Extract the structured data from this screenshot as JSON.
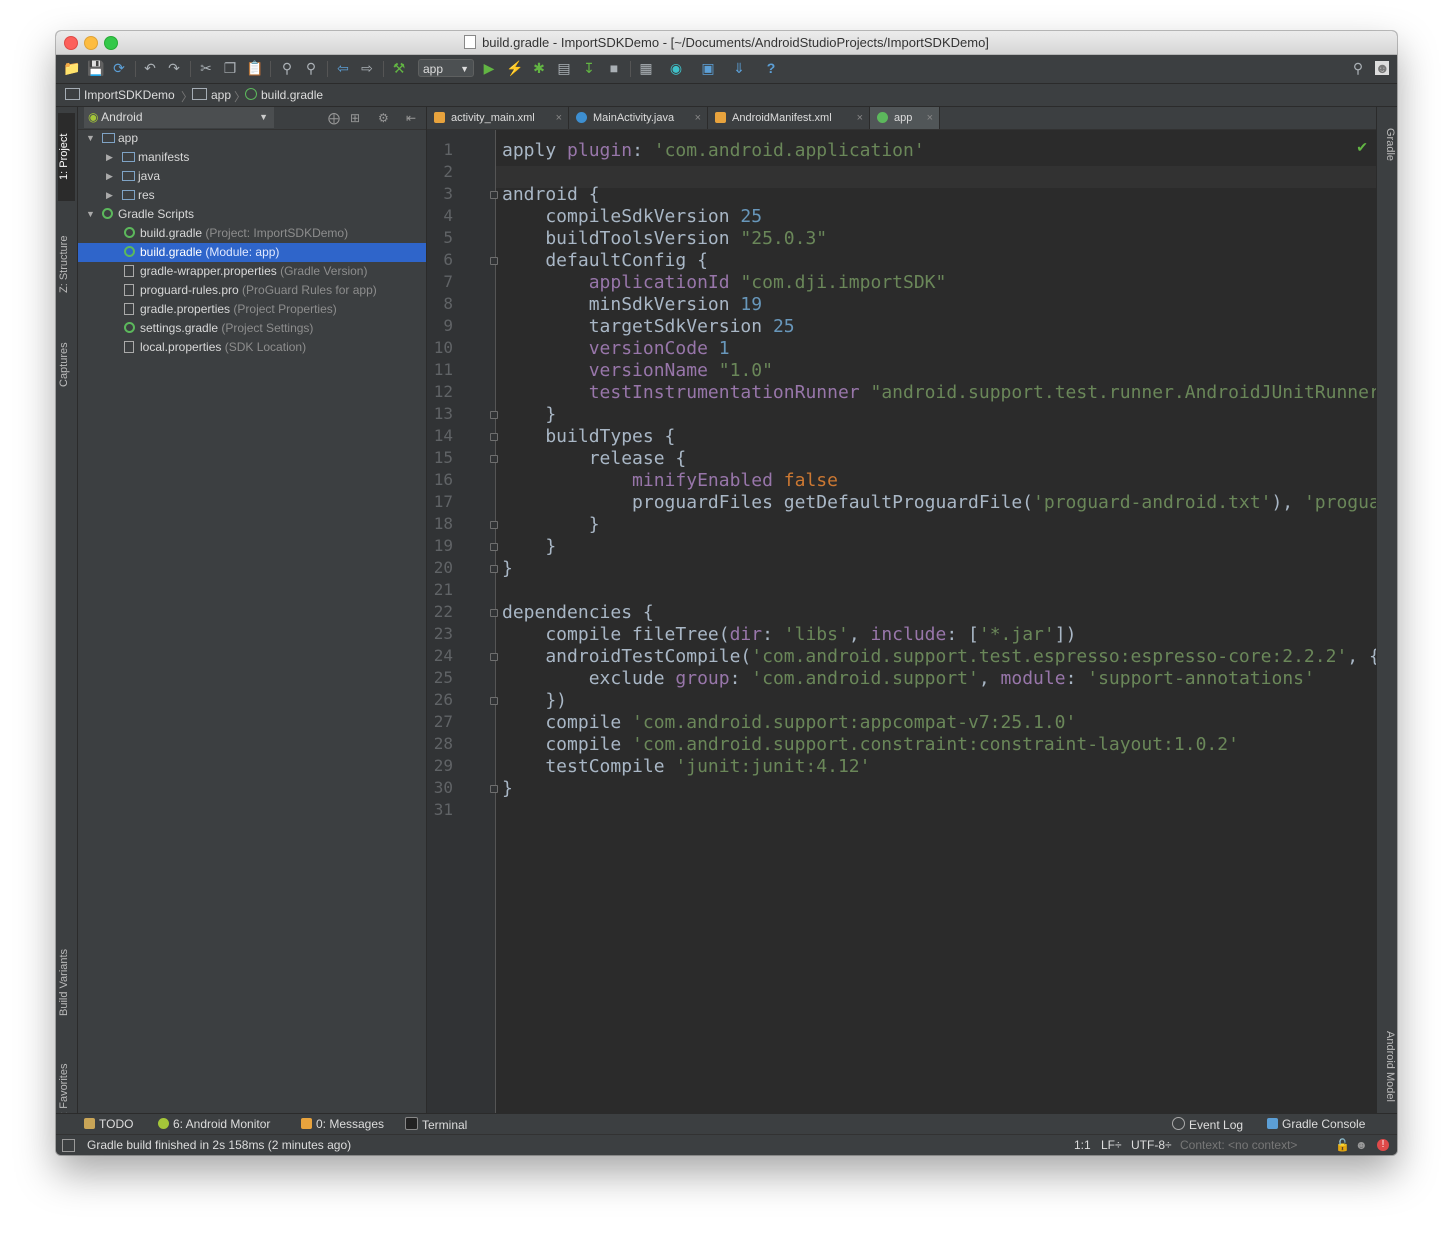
{
  "window": {
    "title": "build.gradle - ImportSDKDemo - [~/Documents/AndroidStudioProjects/ImportSDKDemo]"
  },
  "toolbar": {
    "run_config": "app",
    "help": "?"
  },
  "breadcrumb": [
    "ImportSDKDemo",
    "app",
    "build.gradle"
  ],
  "left_tool_tabs": [
    "1: Project",
    "Z: Structure",
    "Captures",
    "Build Variants",
    "2: Favorites"
  ],
  "right_tool_tabs": [
    "Gradle",
    "Android Model"
  ],
  "project": {
    "view_selector": "Android",
    "tree": [
      {
        "label": "app",
        "hint": "",
        "indent": 0,
        "icon": "module-folder-icon",
        "arrow": "expanded"
      },
      {
        "label": "manifests",
        "hint": "",
        "indent": 1,
        "icon": "folder-icon",
        "arrow": "collapsed"
      },
      {
        "label": "java",
        "hint": "",
        "indent": 1,
        "icon": "folder-icon",
        "arrow": "collapsed"
      },
      {
        "label": "res",
        "hint": "",
        "indent": 1,
        "icon": "res-folder-icon",
        "arrow": "collapsed"
      },
      {
        "label": "Gradle Scripts",
        "hint": "",
        "indent": 0,
        "icon": "gradle-icon",
        "arrow": "expanded"
      },
      {
        "label": "build.gradle",
        "hint": "(Project: ImportSDKDemo)",
        "indent": 1,
        "icon": "gradle-icon",
        "arrow": ""
      },
      {
        "label": "build.gradle",
        "hint": "(Module: app)",
        "indent": 1,
        "icon": "gradle-icon",
        "arrow": "",
        "selected": true
      },
      {
        "label": "gradle-wrapper.properties",
        "hint": "(Gradle Version)",
        "indent": 1,
        "icon": "properties-file-icon",
        "arrow": ""
      },
      {
        "label": "proguard-rules.pro",
        "hint": "(ProGuard Rules for app)",
        "indent": 1,
        "icon": "text-file-icon",
        "arrow": ""
      },
      {
        "label": "gradle.properties",
        "hint": "(Project Properties)",
        "indent": 1,
        "icon": "properties-file-icon",
        "arrow": ""
      },
      {
        "label": "settings.gradle",
        "hint": "(Project Settings)",
        "indent": 1,
        "icon": "gradle-icon",
        "arrow": ""
      },
      {
        "label": "local.properties",
        "hint": "(SDK Location)",
        "indent": 1,
        "icon": "properties-file-icon",
        "arrow": ""
      }
    ]
  },
  "editor": {
    "tabs": [
      {
        "label": "activity_main.xml",
        "icon": "xml-layout-icon",
        "color": "#e8a33d"
      },
      {
        "label": "MainActivity.java",
        "icon": "java-class-icon",
        "color": "#3d8fd1"
      },
      {
        "label": "AndroidManifest.xml",
        "icon": "manifest-icon",
        "color": "#e8a33d"
      },
      {
        "label": "app",
        "icon": "gradle-icon",
        "color": "#5cb85c",
        "active": true
      }
    ],
    "lines": [
      [
        [
          "apply ",
          "t"
        ],
        [
          "plugin",
          "p"
        ],
        [
          ": ",
          "t"
        ],
        [
          "'com.android.application'",
          "s"
        ]
      ],
      [],
      [
        [
          "android {",
          "t"
        ]
      ],
      [
        [
          "    compileSdkVersion ",
          "t"
        ],
        [
          "25",
          "n"
        ]
      ],
      [
        [
          "    buildToolsVersion ",
          "t"
        ],
        [
          "\"25.0.3\"",
          "s"
        ]
      ],
      [
        [
          "    defaultConfig {",
          "t"
        ]
      ],
      [
        [
          "        ",
          "t"
        ],
        [
          "applicationId",
          "u"
        ],
        [
          " ",
          "t"
        ],
        [
          "\"com.dji.importSDK\"",
          "s"
        ]
      ],
      [
        [
          "        minSdkVersion ",
          "t"
        ],
        [
          "19",
          "n"
        ]
      ],
      [
        [
          "        targetSdkVersion ",
          "t"
        ],
        [
          "25",
          "n"
        ]
      ],
      [
        [
          "        ",
          "t"
        ],
        [
          "versionCode",
          "u"
        ],
        [
          " ",
          "t"
        ],
        [
          "1",
          "n"
        ]
      ],
      [
        [
          "        ",
          "t"
        ],
        [
          "versionName",
          "u"
        ],
        [
          " ",
          "t"
        ],
        [
          "\"1.0\"",
          "s"
        ]
      ],
      [
        [
          "        ",
          "t"
        ],
        [
          "testInstrumentationRunner",
          "u"
        ],
        [
          " ",
          "t"
        ],
        [
          "\"android.support.test.runner.AndroidJUnitRunner\"",
          "s"
        ]
      ],
      [
        [
          "    }",
          "t"
        ]
      ],
      [
        [
          "    buildTypes {",
          "t"
        ]
      ],
      [
        [
          "        release {",
          "t"
        ]
      ],
      [
        [
          "            ",
          "t"
        ],
        [
          "minifyEnabled",
          "u"
        ],
        [
          " ",
          "t"
        ],
        [
          "false",
          "k"
        ]
      ],
      [
        [
          "            proguardFiles getDefaultProguardFile(",
          "t"
        ],
        [
          "'proguard-android.txt'",
          "s"
        ],
        [
          "), ",
          "t"
        ],
        [
          "'proguard-rules.pro'",
          "s"
        ]
      ],
      [
        [
          "        }",
          "t"
        ]
      ],
      [
        [
          "    }",
          "t"
        ]
      ],
      [
        [
          "}",
          "t"
        ]
      ],
      [],
      [
        [
          "dependencies {",
          "t"
        ]
      ],
      [
        [
          "    compile fileTree(",
          "t"
        ],
        [
          "dir",
          "p"
        ],
        [
          ": ",
          "t"
        ],
        [
          "'libs'",
          "s"
        ],
        [
          ", ",
          "t"
        ],
        [
          "include",
          "p"
        ],
        [
          ": [",
          "t"
        ],
        [
          "'*.jar'",
          "s"
        ],
        [
          "])",
          "t"
        ]
      ],
      [
        [
          "    androidTestCompile(",
          "t"
        ],
        [
          "'com.android.support.test.espresso:espresso-core:2.2.2'",
          "s"
        ],
        [
          ", {",
          "t"
        ]
      ],
      [
        [
          "        exclude ",
          "t"
        ],
        [
          "group",
          "p"
        ],
        [
          ": ",
          "t"
        ],
        [
          "'com.android.support'",
          "s"
        ],
        [
          ", ",
          "t"
        ],
        [
          "module",
          "p"
        ],
        [
          ": ",
          "t"
        ],
        [
          "'support-annotations'",
          "s"
        ]
      ],
      [
        [
          "    })",
          "t"
        ]
      ],
      [
        [
          "    compile ",
          "t"
        ],
        [
          "'com.android.support:appcompat-v7:25.1.0'",
          "s"
        ]
      ],
      [
        [
          "    compile ",
          "t"
        ],
        [
          "'com.android.support.constraint:constraint-layout:1.0.2'",
          "s"
        ]
      ],
      [
        [
          "    testCompile ",
          "t"
        ],
        [
          "'junit:junit:4.12'",
          "s"
        ]
      ],
      [
        [
          "}",
          "t"
        ]
      ],
      []
    ]
  },
  "bottom_tools": {
    "todo": "TODO",
    "android_monitor": "6: Android Monitor",
    "messages": "0: Messages",
    "terminal": "Terminal",
    "event_log": "Event Log",
    "gradle_console": "Gradle Console"
  },
  "status": {
    "message": "Gradle build finished in 2s 158ms (2 minutes ago)",
    "position": "1:1",
    "line_sep": "LF÷",
    "encoding": "UTF-8÷",
    "context": "Context: <no context>"
  },
  "colors": {
    "keyword": "#cc7832",
    "string": "#6a8759",
    "number": "#6897bb",
    "property": "#9876aa",
    "text": "#a9b7c6",
    "selection": "#2f65ca"
  }
}
